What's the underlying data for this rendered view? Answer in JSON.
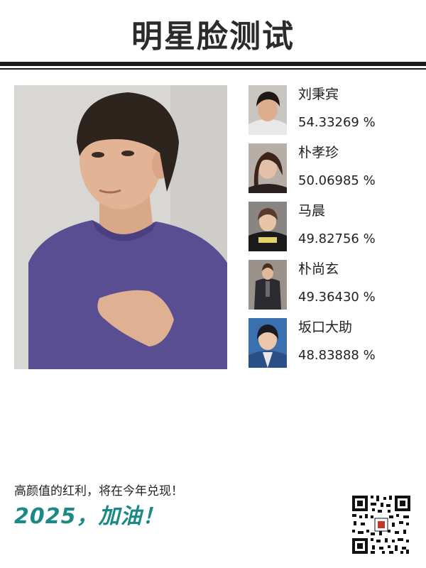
{
  "header": {
    "title": "明星脸测试"
  },
  "user_photo": {
    "alt": "user portrait",
    "shirt_color": "#5a4e92",
    "bg_color": "#d8d6d2"
  },
  "matches": [
    {
      "name": "刘秉宾",
      "score": "54.33269 %"
    },
    {
      "name": "朴孝珍",
      "score": "50.06985 %"
    },
    {
      "name": "马晨",
      "score": "49.82756 %"
    },
    {
      "name": "朴尚玄",
      "score": "49.36430 %"
    },
    {
      "name": "坂口大助",
      "score": "48.83888 %"
    }
  ],
  "footer": {
    "tagline": "高颜值的红利，将在今年兑现！",
    "slogan": "2025，加油！",
    "accent_color": "#1b8a86"
  },
  "qr_code": {
    "icon": "qr-code-icon"
  }
}
